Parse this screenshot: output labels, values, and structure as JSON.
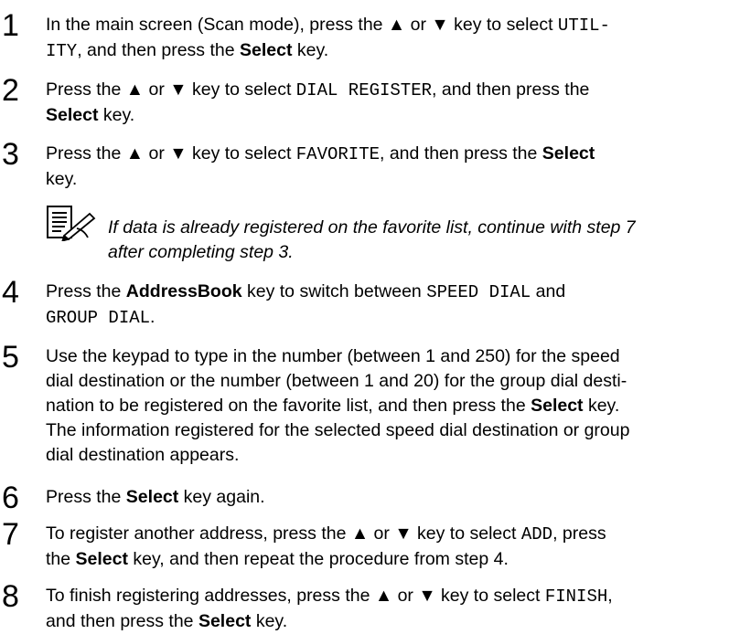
{
  "steps": [
    {
      "num": "1",
      "parts": [
        {
          "t": "In the main screen (Scan mode), press the ▲ or ▼ key to select "
        },
        {
          "t": "UTIL-",
          "m": true
        },
        {
          "br": true
        },
        {
          "t": "ITY",
          "m": true
        },
        {
          "t": ", and then press the "
        },
        {
          "t": "Select",
          "b": true
        },
        {
          "t": " key."
        }
      ]
    },
    {
      "num": "2",
      "parts": [
        {
          "t": "Press the ▲ or ▼ key to select "
        },
        {
          "t": "DIAL REGISTER",
          "m": true
        },
        {
          "t": ", and then press the"
        },
        {
          "br": true
        },
        {
          "t": "Select",
          "b": true
        },
        {
          "t": " key."
        }
      ]
    },
    {
      "num": "3",
      "parts": [
        {
          "t": "Press the ▲ or ▼ key to select "
        },
        {
          "t": "FAVORITE",
          "m": true
        },
        {
          "t": ", and then press the "
        },
        {
          "t": "Select",
          "b": true
        },
        {
          "br": true
        },
        {
          "t": "key."
        }
      ]
    },
    {
      "num": "4",
      "parts": [
        {
          "t": "Press the "
        },
        {
          "t": "AddressBook",
          "b": true
        },
        {
          "t": " key to switch between "
        },
        {
          "t": "SPEED DIAL",
          "m": true
        },
        {
          "t": " and"
        },
        {
          "br": true
        },
        {
          "t": "GROUP DIAL",
          "m": true
        },
        {
          "t": "."
        }
      ]
    },
    {
      "num": "5",
      "parts": [
        {
          "t": "Use the keypad to type in the number (between 1 and 250) for the speed"
        },
        {
          "br": true
        },
        {
          "t": "dial destination or the number (between 1 and 20) for the group dial desti-"
        },
        {
          "br": true
        },
        {
          "t": "nation to be registered on the favorite list, and then press the "
        },
        {
          "t": "Select",
          "b": true
        },
        {
          "t": " key."
        },
        {
          "br": true
        },
        {
          "t": "The information registered for the selected speed dial destination or group"
        },
        {
          "br": true
        },
        {
          "t": "dial destination appears."
        }
      ]
    },
    {
      "num": "6",
      "parts": [
        {
          "t": "Press the "
        },
        {
          "t": "Select",
          "b": true
        },
        {
          "t": " key again."
        }
      ]
    },
    {
      "num": "7",
      "parts": [
        {
          "t": "To register another address, press the ▲ or ▼ key to select "
        },
        {
          "t": "ADD",
          "m": true
        },
        {
          "t": ", press"
        },
        {
          "br": true
        },
        {
          "t": "the "
        },
        {
          "t": "Select",
          "b": true
        },
        {
          "t": " key, and then repeat the procedure from step 4."
        }
      ]
    },
    {
      "num": "8",
      "parts": [
        {
          "t": "To finish registering addresses, press the ▲ or ▼ key to select "
        },
        {
          "t": "FINISH",
          "m": true
        },
        {
          "t": ","
        },
        {
          "br": true
        },
        {
          "t": "and then press the "
        },
        {
          "t": "Select",
          "b": true
        },
        {
          "t": " key."
        }
      ]
    }
  ],
  "note": {
    "icon": "note-pad-pencil-icon",
    "line1": "If data is already registered on the favorite list, continue with step 7",
    "line2": "after completing step 3."
  }
}
